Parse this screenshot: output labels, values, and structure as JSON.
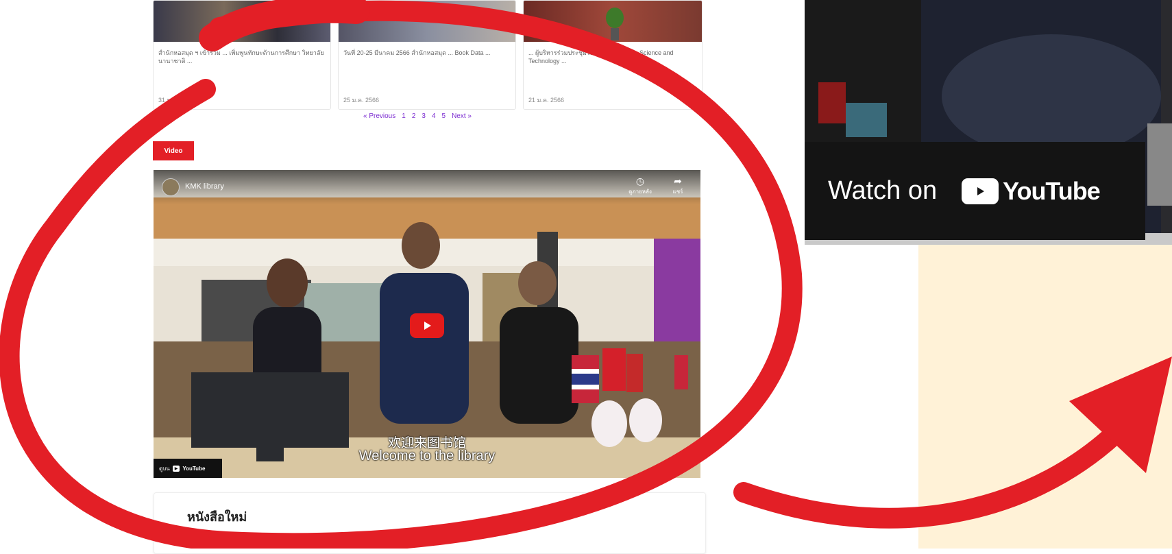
{
  "news": {
    "cards": [
      {
        "excerpt": "สำนักหอสมุด ฯ เข้าร่วม ... เพิ่มพูนทักษะด้านการศึกษา วิทยาลัยนานาชาติ ...",
        "date": "31 ม.ค. 2566"
      },
      {
        "excerpt": "วันที่ 20-25 มีนาคม 2566 สำนักหอสมุด ... Book Data ...",
        "date": "25 ม.ค. 2566"
      },
      {
        "excerpt": "... ผู้บริหารร่วมประชุมโครงการส่งเสริม ... Science and Technology ...",
        "date": "21 ม.ค. 2566"
      }
    ],
    "pagination": {
      "previous": "« Previous",
      "pages": [
        "1",
        "2",
        "3",
        "4",
        "5"
      ],
      "next": "Next »"
    }
  },
  "video_section": {
    "tag": "Video",
    "player": {
      "title": "KMK library",
      "watch_later": "ดูภายหลัง",
      "share": "แชร์",
      "subtitle_cn": "欢迎来图书馆",
      "subtitle_en": "Welcome to the library",
      "watch_on": "ดูบน",
      "youtube_word": "YouTube"
    }
  },
  "new_books": {
    "title": "หนังสือใหม่"
  },
  "zoom": {
    "watch_on": "Watch on",
    "youtube_word": "YouTube"
  },
  "colors": {
    "accent_red": "#e31f26",
    "youtube_red": "#e31b1b",
    "cream": "#fff2d7",
    "link_purple": "#7b2bd1"
  }
}
